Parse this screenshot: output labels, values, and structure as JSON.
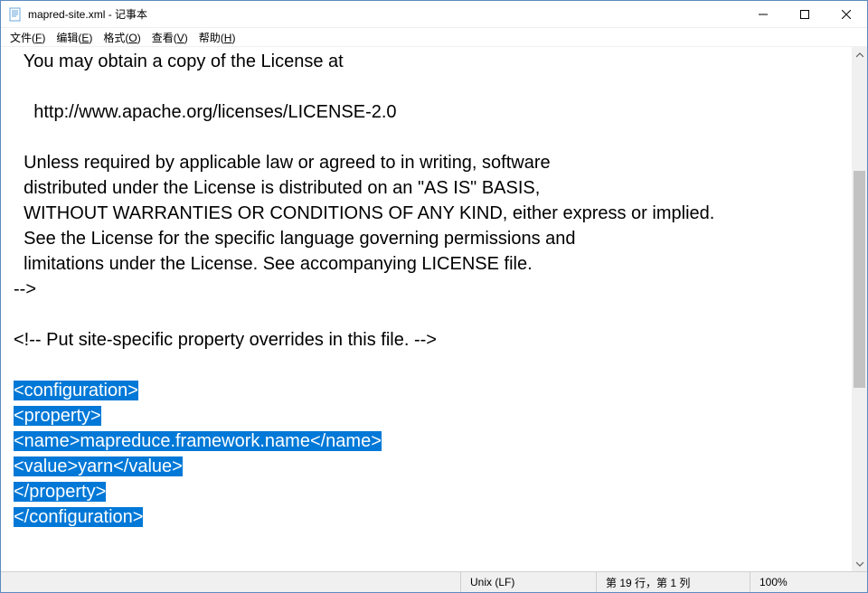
{
  "titlebar": {
    "title": "mapred-site.xml - 记事本"
  },
  "menu": {
    "file": {
      "label": "文件",
      "accel": "F"
    },
    "edit": {
      "label": "编辑",
      "accel": "E"
    },
    "format": {
      "label": "格式",
      "accel": "O"
    },
    "view": {
      "label": "查看",
      "accel": "V"
    },
    "help": {
      "label": "帮助",
      "accel": "H"
    }
  },
  "content": {
    "lines_plain": [
      "  You may obtain a copy of the License at",
      "",
      "    http://www.apache.org/licenses/LICENSE-2.0",
      "",
      "  Unless required by applicable law or agreed to in writing, software",
      "  distributed under the License is distributed on an \"AS IS\" BASIS,",
      "  WITHOUT WARRANTIES OR CONDITIONS OF ANY KIND, either express or implied.",
      "  See the License for the specific language governing permissions and",
      "  limitations under the License. See accompanying LICENSE file.",
      "-->",
      "",
      "<!-- Put site-specific property overrides in this file. -->",
      ""
    ],
    "lines_selected": [
      "<configuration>",
      "<property>",
      "<name>mapreduce.framework.name</name>",
      "<value>yarn</value>",
      "</property>",
      "</configuration>"
    ]
  },
  "status": {
    "encoding": "Unix (LF)",
    "position": "第 19 行，第 1 列",
    "zoom": "100%"
  }
}
